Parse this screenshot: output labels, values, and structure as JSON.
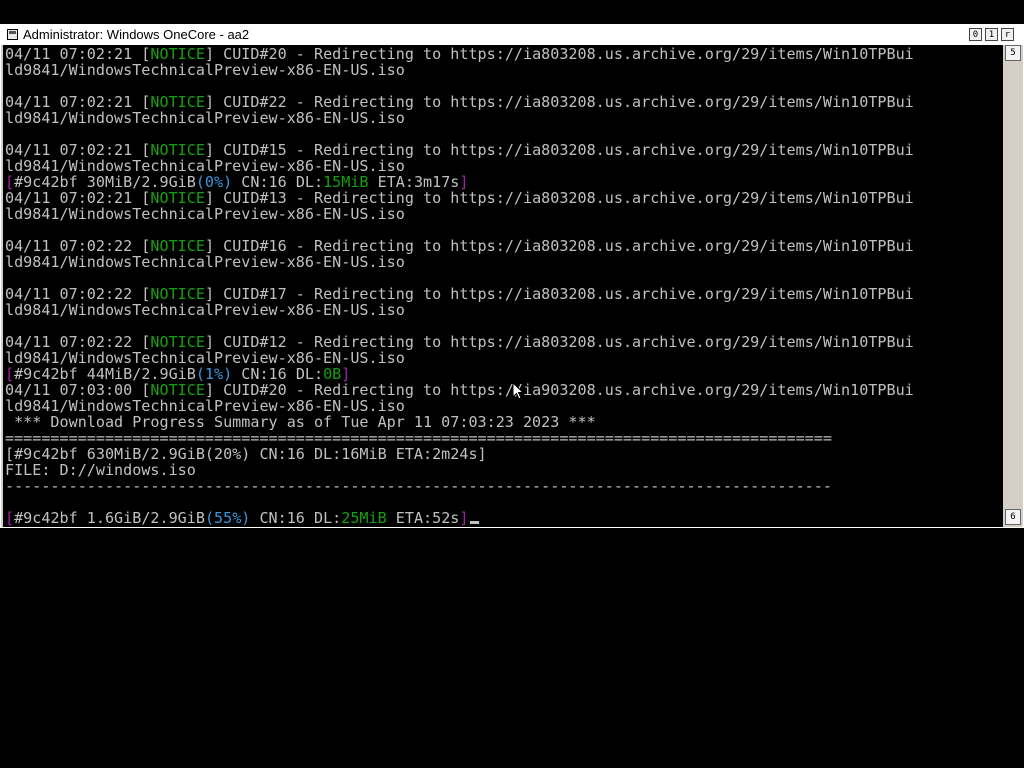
{
  "window": {
    "title": "Administrator:  Windows OneCore - aa2",
    "controls": {
      "minimize": "0",
      "maximize": "1",
      "close": "r"
    }
  },
  "scrollbar": {
    "up": "5",
    "down": "6"
  },
  "colors": {
    "notice": "#13a10e",
    "progress_bracket": "#a020a0",
    "speed": "#13a10e",
    "percent": "#3a96dd"
  },
  "console": {
    "lines": [
      [
        {
          "t": "04/11 07:02:21 ["
        },
        {
          "t": "NOTICE",
          "c": "g"
        },
        {
          "t": "] CUID#20 - Redirecting to https://ia803208.us.archive.org/29/items/Win10TPBui"
        }
      ],
      [
        {
          "t": "ld9841/WindowsTechnicalPreview-x86-EN-US.iso"
        }
      ],
      [],
      [
        {
          "t": "04/11 07:02:21 ["
        },
        {
          "t": "NOTICE",
          "c": "g"
        },
        {
          "t": "] CUID#22 - Redirecting to https://ia803208.us.archive.org/29/items/Win10TPBui"
        }
      ],
      [
        {
          "t": "ld9841/WindowsTechnicalPreview-x86-EN-US.iso"
        }
      ],
      [],
      [
        {
          "t": "04/11 07:02:21 ["
        },
        {
          "t": "NOTICE",
          "c": "g"
        },
        {
          "t": "] CUID#15 - Redirecting to https://ia803208.us.archive.org/29/items/Win10TPBui"
        }
      ],
      [
        {
          "t": "ld9841/WindowsTechnicalPreview-x86-EN-US.iso"
        }
      ],
      [
        {
          "t": "[",
          "c": "m"
        },
        {
          "t": "#9c42bf 30MiB/2.9GiB"
        },
        {
          "t": "(0%)",
          "c": "cy"
        },
        {
          "t": " CN:16 DL:"
        },
        {
          "t": "15MiB",
          "c": "g"
        },
        {
          "t": " ETA:3m17s"
        },
        {
          "t": "]",
          "c": "m"
        }
      ],
      [
        {
          "t": "04/11 07:02:21 ["
        },
        {
          "t": "NOTICE",
          "c": "g"
        },
        {
          "t": "] CUID#13 - Redirecting to https://ia803208.us.archive.org/29/items/Win10TPBui"
        }
      ],
      [
        {
          "t": "ld9841/WindowsTechnicalPreview-x86-EN-US.iso"
        }
      ],
      [],
      [
        {
          "t": "04/11 07:02:22 ["
        },
        {
          "t": "NOTICE",
          "c": "g"
        },
        {
          "t": "] CUID#16 - Redirecting to https://ia803208.us.archive.org/29/items/Win10TPBui"
        }
      ],
      [
        {
          "t": "ld9841/WindowsTechnicalPreview-x86-EN-US.iso"
        }
      ],
      [],
      [
        {
          "t": "04/11 07:02:22 ["
        },
        {
          "t": "NOTICE",
          "c": "g"
        },
        {
          "t": "] CUID#17 - Redirecting to https://ia803208.us.archive.org/29/items/Win10TPBui"
        }
      ],
      [
        {
          "t": "ld9841/WindowsTechnicalPreview-x86-EN-US.iso"
        }
      ],
      [],
      [
        {
          "t": "04/11 07:02:22 ["
        },
        {
          "t": "NOTICE",
          "c": "g"
        },
        {
          "t": "] CUID#12 - Redirecting to https://ia803208.us.archive.org/29/items/Win10TPBui"
        }
      ],
      [
        {
          "t": "ld9841/WindowsTechnicalPreview-x86-EN-US.iso"
        }
      ],
      [
        {
          "t": "[",
          "c": "m"
        },
        {
          "t": "#9c42bf 44MiB/2.9GiB"
        },
        {
          "t": "(1%)",
          "c": "cy"
        },
        {
          "t": " CN:16 DL:"
        },
        {
          "t": "0B",
          "c": "g"
        },
        {
          "t": "]",
          "c": "m"
        }
      ],
      [
        {
          "t": "04/11 07:03:00 ["
        },
        {
          "t": "NOTICE",
          "c": "g"
        },
        {
          "t": "] CUID#20 - Redirecting to https://ia903208.us.archive.org/29/items/Win10TPBui"
        }
      ],
      [
        {
          "t": "ld9841/WindowsTechnicalPreview-x86-EN-US.iso"
        }
      ],
      [
        {
          "t": " *** Download Progress Summary as of Tue Apr 11 07:03:23 2023 ***"
        }
      ],
      [
        {
          "t": "==========================================================================================="
        }
      ],
      [
        {
          "t": "[#9c42bf 630MiB/2.9GiB(20%) CN:16 DL:16MiB ETA:2m24s]"
        }
      ],
      [
        {
          "t": "FILE: D://windows.iso"
        }
      ],
      [
        {
          "t": "-------------------------------------------------------------------------------------------"
        }
      ],
      [],
      [
        {
          "t": "[",
          "c": "m"
        },
        {
          "t": "#9c42bf 1.6GiB/2.9GiB"
        },
        {
          "t": "(55%)",
          "c": "cy"
        },
        {
          "t": " CN:16 DL:"
        },
        {
          "t": "25MiB",
          "c": "g"
        },
        {
          "t": " ETA:52s"
        },
        {
          "t": "]",
          "c": "m"
        }
      ]
    ]
  }
}
